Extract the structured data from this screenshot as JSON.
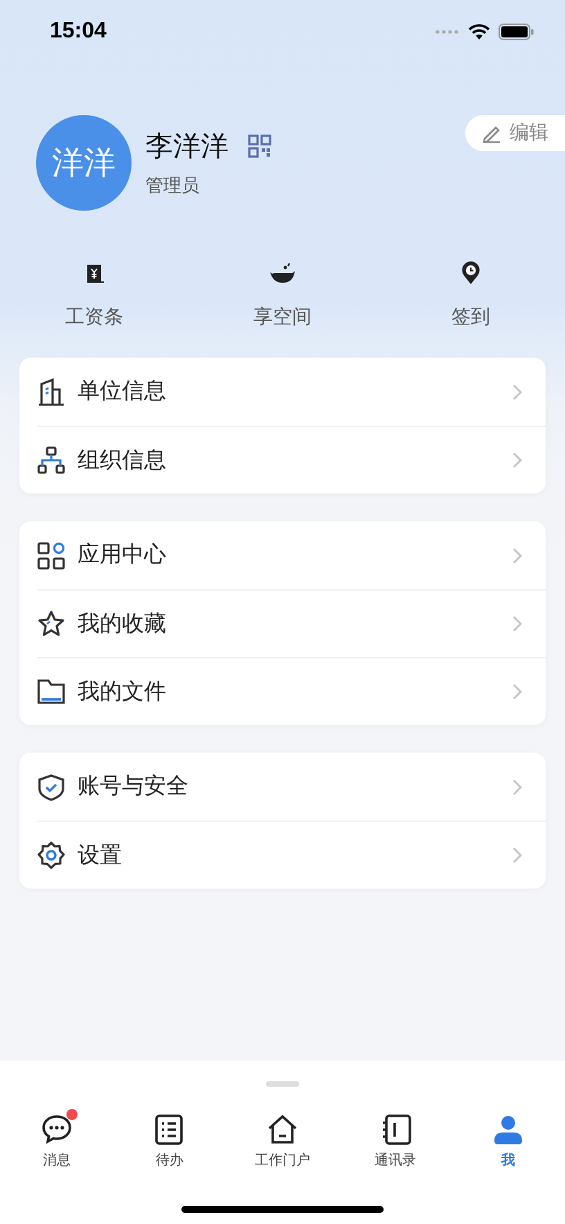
{
  "status_bar": {
    "time": "15:04"
  },
  "profile": {
    "avatar_text": "洋洋",
    "name": "李洋洋",
    "role": "管理员",
    "edit_button": "编辑"
  },
  "shortcuts": [
    {
      "label": "工资条"
    },
    {
      "label": "享空间"
    },
    {
      "label": "签到"
    }
  ],
  "menu_groups": [
    [
      {
        "label": "单位信息"
      },
      {
        "label": "组织信息"
      }
    ],
    [
      {
        "label": "应用中心"
      },
      {
        "label": "我的收藏"
      },
      {
        "label": "我的文件"
      }
    ],
    [
      {
        "label": "账号与安全"
      },
      {
        "label": "设置"
      }
    ]
  ],
  "tab_bar": [
    {
      "label": "消息",
      "selected": false,
      "badge": true
    },
    {
      "label": "待办",
      "selected": false,
      "badge": false
    },
    {
      "label": "工作门户",
      "selected": false,
      "badge": false
    },
    {
      "label": "通讯录",
      "selected": false,
      "badge": false
    },
    {
      "label": "我",
      "selected": true,
      "badge": false
    }
  ]
}
